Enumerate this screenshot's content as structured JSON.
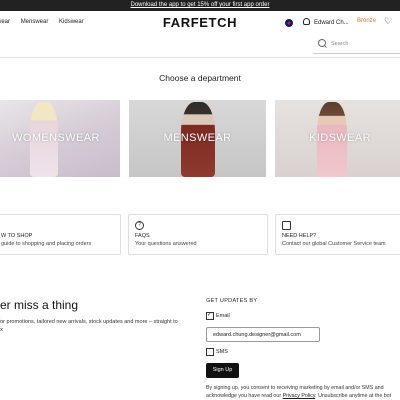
{
  "promo": {
    "text": "Download the app to get 15% off your first app order"
  },
  "header": {
    "nav": [
      "swear",
      "Menswear",
      "Kidswear"
    ],
    "logo": "FARFETCH",
    "user_name": "Edward Ch...",
    "tier": "Bronze",
    "search_placeholder": "Search"
  },
  "departments": {
    "title": "Choose a department",
    "tiles": [
      {
        "label": "WOMENSWEAR"
      },
      {
        "label": "MENSWEAR"
      },
      {
        "label": "KIDSWEAR"
      }
    ]
  },
  "help_cards": [
    {
      "title": "W TO SHOP",
      "subtitle": "guide to shopping and placing orders"
    },
    {
      "icon": "?",
      "title": "FAQS",
      "subtitle": "Your questions answered"
    },
    {
      "title": "NEED HELP?",
      "subtitle": "Contact our global Customer Service team"
    }
  ],
  "newsletter": {
    "heading": "ver miss a thing",
    "sub_line1": "e for promotions, tailored new arrivals, stock updates and more – straight to",
    "sub_line2": "box",
    "updates_label": "GET UPDATES BY",
    "email_label": "Email",
    "email_checked": true,
    "email_value": "edward.chung.designer@gmail.com",
    "sms_label": "SMS",
    "sms_checked": false,
    "signup_label": "Sign Up",
    "legal_line1": "By signing up, you consent to receiving marketing by email and/or SMS and",
    "legal_line2_pre": "acknowledge you have read our ",
    "legal_link": "Privacy Policy",
    "legal_line2_post": ". Unsubscribe anytime at the bot"
  },
  "colors": {
    "accent_bronze": "#c77b33",
    "dark": "#111111"
  }
}
